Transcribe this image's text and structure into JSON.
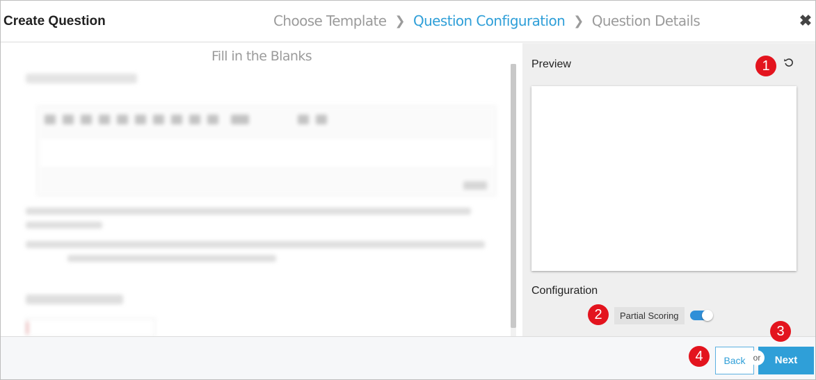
{
  "header": {
    "title": "Create Question",
    "steps": [
      {
        "label": "Choose Template"
      },
      {
        "label": "Question Configuration"
      },
      {
        "label": "Question Details"
      }
    ],
    "close_icon": "close-icon"
  },
  "left": {
    "template_name": "Fill in the Blanks"
  },
  "right": {
    "preview_label": "Preview",
    "reset_icon": "reset-icon",
    "configuration_label": "Configuration",
    "partial_scoring_label": "Partial Scoring",
    "partial_scoring_enabled": true
  },
  "footer": {
    "back_label": "Back",
    "or_label": "or",
    "next_label": "Next"
  },
  "callouts": [
    "1",
    "2",
    "3",
    "4"
  ],
  "colors": {
    "accent": "#2f9fd8",
    "badge": "#e3141e",
    "inactive_step": "#9b9b9b"
  }
}
